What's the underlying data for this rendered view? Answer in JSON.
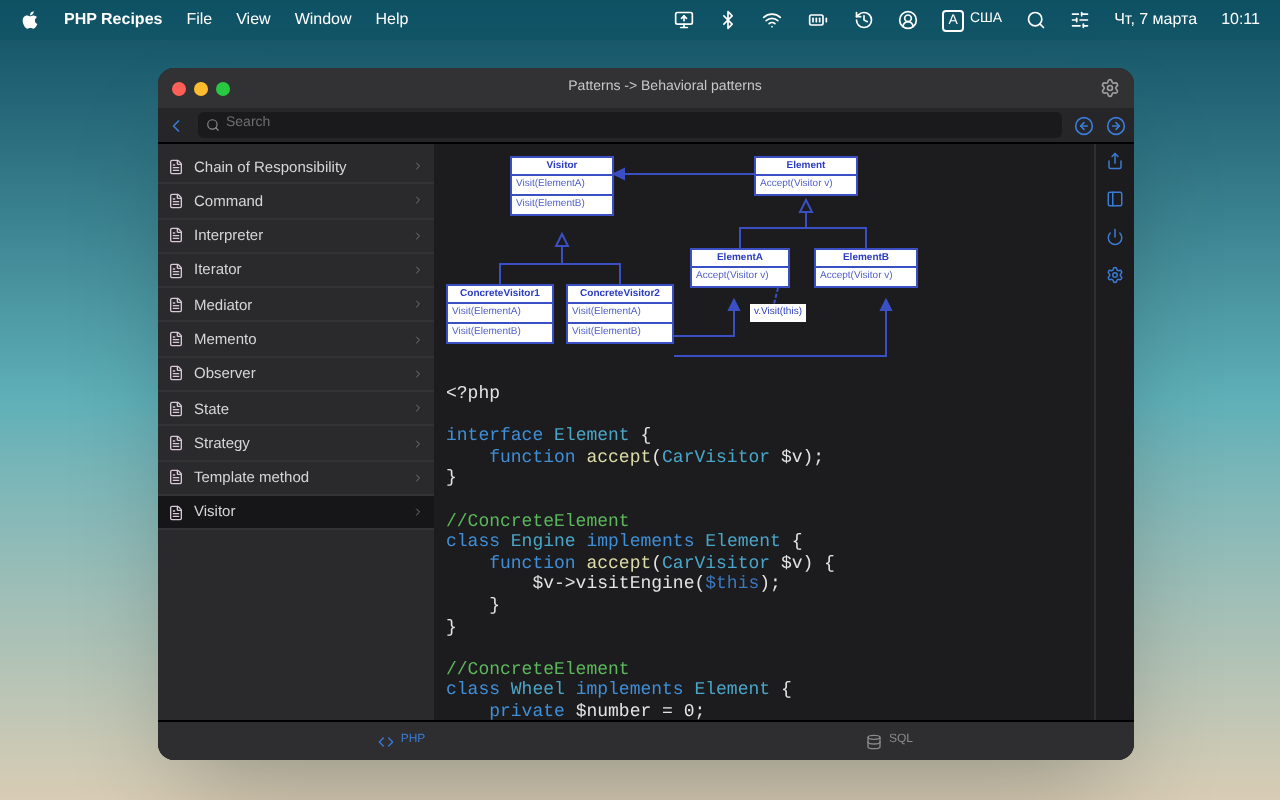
{
  "menu_bar": {
    "app_name": "PHP Recipes",
    "menus": [
      "File",
      "View",
      "Window",
      "Help"
    ],
    "input_source": "A",
    "region": "США",
    "date": "Чт, 7 марта",
    "time": "10:11"
  },
  "window": {
    "title": "Patterns -> Behavioral patterns"
  },
  "search": {
    "placeholder": "Search"
  },
  "sidebar": {
    "items": [
      {
        "label": "Chain of Responsibility",
        "selected": false
      },
      {
        "label": "Command",
        "selected": false
      },
      {
        "label": "Interpreter",
        "selected": false
      },
      {
        "label": "Iterator",
        "selected": false
      },
      {
        "label": "Mediator",
        "selected": false
      },
      {
        "label": "Memento",
        "selected": false
      },
      {
        "label": "Observer",
        "selected": false
      },
      {
        "label": "State",
        "selected": false
      },
      {
        "label": "Strategy",
        "selected": false
      },
      {
        "label": "Template method",
        "selected": false
      },
      {
        "label": "Visitor",
        "selected": true
      }
    ]
  },
  "diagram": {
    "nodes": [
      {
        "title": "Visitor",
        "methods": [
          "Visit(ElementA)",
          "Visit(ElementB)"
        ]
      },
      {
        "title": "Element",
        "methods": [
          "Accept(Visitor v)"
        ]
      },
      {
        "title": "ElementA",
        "methods": [
          "Accept(Visitor v)"
        ]
      },
      {
        "title": "ElementB",
        "methods": [
          "Accept(Visitor v)"
        ]
      },
      {
        "title": "ConcreteVisitor1",
        "methods": [
          "Visit(ElementA)",
          "Visit(ElementB)"
        ]
      },
      {
        "title": "ConcreteVisitor2",
        "methods": [
          "Visit(ElementA)",
          "Visit(ElementB)"
        ]
      }
    ],
    "note": "v.Visit(this)"
  },
  "code": {
    "blocks": [
      [
        [
          {
            "kind": "plain",
            "text": "<?php"
          }
        ]
      ],
      [
        [
          {
            "kind": "keyword",
            "text": "interface "
          },
          {
            "kind": "type",
            "text": "Element"
          },
          {
            "kind": "plain",
            "text": " {"
          }
        ],
        [
          {
            "kind": "keyword",
            "text": "    function "
          },
          {
            "kind": "function",
            "text": "accept"
          },
          {
            "kind": "plain",
            "text": "("
          },
          {
            "kind": "type",
            "text": "CarVisitor"
          },
          {
            "kind": "plain",
            "text": " $v);"
          }
        ],
        [
          {
            "kind": "plain",
            "text": "}"
          }
        ]
      ],
      [
        [
          {
            "kind": "comment",
            "text": "//ConcreteElement"
          }
        ],
        [
          {
            "kind": "keyword",
            "text": "class "
          },
          {
            "kind": "type",
            "text": "Engine "
          },
          {
            "kind": "keyword",
            "text": "implements "
          },
          {
            "kind": "type",
            "text": "Element"
          },
          {
            "kind": "plain",
            "text": " {"
          }
        ],
        [
          {
            "kind": "keyword",
            "text": "    function "
          },
          {
            "kind": "function",
            "text": "accept"
          },
          {
            "kind": "plain",
            "text": "("
          },
          {
            "kind": "type",
            "text": "CarVisitor"
          },
          {
            "kind": "plain",
            "text": " $v) {"
          }
        ],
        [
          {
            "kind": "plain",
            "text": "        $v->visitEngine("
          },
          {
            "kind": "variable",
            "text": "$this"
          },
          {
            "kind": "plain",
            "text": ");"
          }
        ],
        [
          {
            "kind": "plain",
            "text": "    }"
          }
        ],
        [
          {
            "kind": "plain",
            "text": "}"
          }
        ]
      ],
      [
        [
          {
            "kind": "comment",
            "text": "//ConcreteElement"
          }
        ],
        [
          {
            "kind": "keyword",
            "text": "class "
          },
          {
            "kind": "type",
            "text": "Wheel "
          },
          {
            "kind": "keyword",
            "text": "implements "
          },
          {
            "kind": "type",
            "text": "Element"
          },
          {
            "kind": "plain",
            "text": " {"
          }
        ],
        [
          {
            "kind": "keyword",
            "text": "    private "
          },
          {
            "kind": "plain",
            "text": "$number = 0;"
          }
        ]
      ]
    ]
  },
  "tabs": [
    {
      "label": "PHP",
      "selected": true
    },
    {
      "label": "SQL",
      "selected": false
    }
  ]
}
